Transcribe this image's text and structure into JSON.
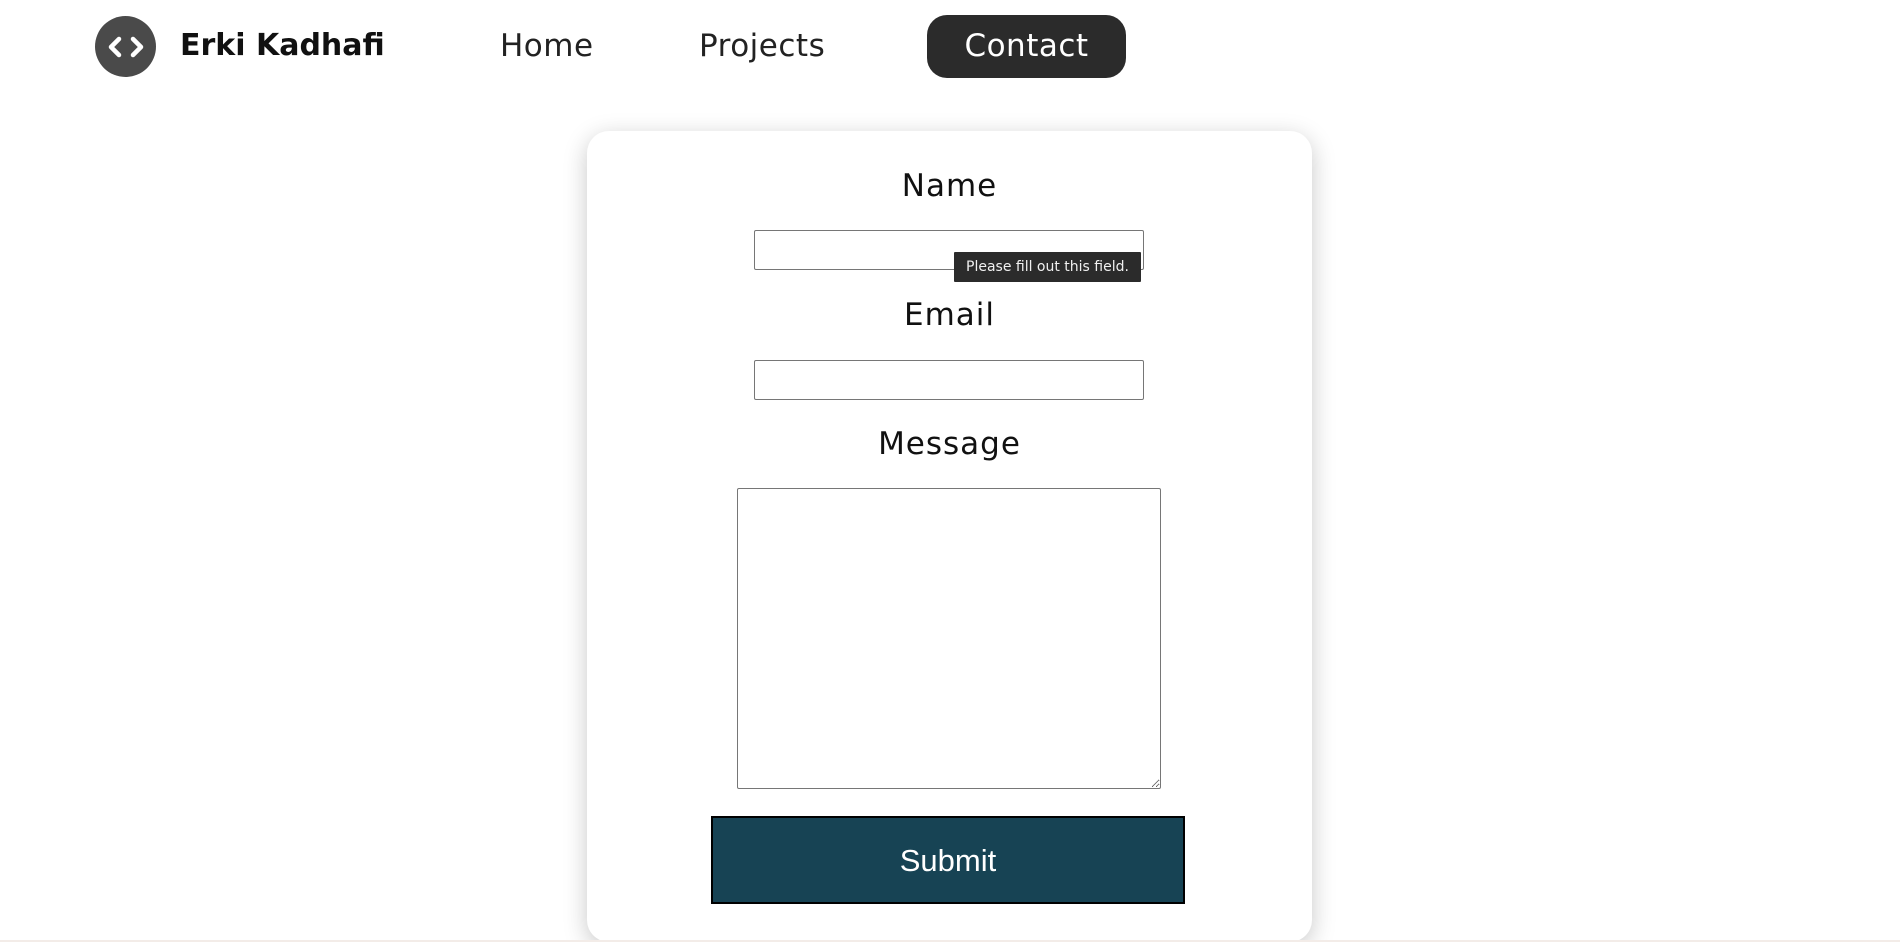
{
  "header": {
    "logo_icon": "code-brackets-icon",
    "brand": "Erki Kadhafi",
    "nav": [
      {
        "label": "Home"
      },
      {
        "label": "Projects"
      },
      {
        "label": "Contact",
        "active": true
      }
    ]
  },
  "form": {
    "name_label": "Name",
    "name_value": "",
    "email_label": "Email",
    "email_value": "",
    "message_label": "Message",
    "message_value": "",
    "submit_label": "Submit",
    "validation_tooltip": "Please fill out this field."
  },
  "colors": {
    "contact_button_bg": "#2b2b2b",
    "submit_bg": "#174354",
    "logo_bg": "#4a4a4a"
  }
}
